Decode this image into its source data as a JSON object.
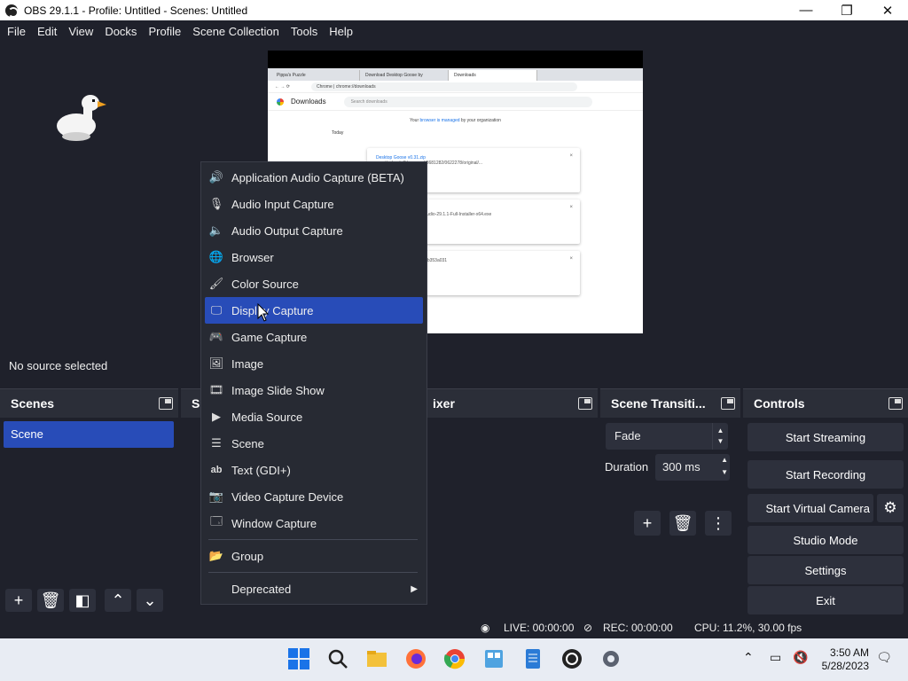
{
  "window": {
    "title": "OBS 29.1.1 - Profile: Untitled - Scenes: Untitled",
    "minimize": "—",
    "maximize": "❐",
    "close": "✕"
  },
  "menubar": [
    "File",
    "Edit",
    "View",
    "Docks",
    "Profile",
    "Scene Collection",
    "Tools",
    "Help"
  ],
  "preview_browser": {
    "tabs": [
      "Pippa's Puzzle",
      "Download Desktop Goose by",
      "Downloads"
    ],
    "url": "Chrome | chrome://downloads",
    "heading": "Downloads",
    "search_placeholder": "Search downloads",
    "managed_pre": "Your ",
    "managed_link": "browser is managed",
    "managed_post": " by your organization",
    "today": "Today",
    "cards": [
      {
        "name": "Desktop Goose v0.31.zip",
        "detail": "...net/uploads/5/gumroad/3681282/0622278/original/..."
      },
      {
        "name": "...dio-x64.exe",
        "detail": "...com/downloads/OBS-Studio-29.1.1-Full-Installer-x64.exe"
      },
      {
        "name": "",
        "detail": "...e-a78b-43dc-8608-33eab353a031"
      }
    ]
  },
  "source_bar": {
    "text": "No source selected"
  },
  "scenes_dock": {
    "title": "Scenes",
    "items": [
      "Scene"
    ]
  },
  "sources_dock": {
    "title_partial": "Sc"
  },
  "mixer_dock": {
    "title_partial": "ixer"
  },
  "transitions_dock": {
    "title": "Scene Transiti...",
    "transition": "Fade",
    "duration_label": "Duration",
    "duration_value": "300 ms"
  },
  "controls_dock": {
    "title": "Controls",
    "buttons": [
      "Start Streaming",
      "Start Recording",
      "Start Virtual Camera",
      "Studio Mode",
      "Settings",
      "Exit"
    ]
  },
  "context_menu": {
    "items": [
      {
        "label": "Application Audio Capture (BETA)",
        "icon": "app-audio-icon"
      },
      {
        "label": "Audio Input Capture",
        "icon": "microphone-icon"
      },
      {
        "label": "Audio Output Capture",
        "icon": "speaker-icon"
      },
      {
        "label": "Browser",
        "icon": "globe-icon"
      },
      {
        "label": "Color Source",
        "icon": "brush-icon"
      },
      {
        "label": "Display Capture",
        "icon": "monitor-icon"
      },
      {
        "label": "Game Capture",
        "icon": "gamepad-icon"
      },
      {
        "label": "Image",
        "icon": "image-icon"
      },
      {
        "label": "Image Slide Show",
        "icon": "slideshow-icon"
      },
      {
        "label": "Media Source",
        "icon": "play-icon"
      },
      {
        "label": "Scene",
        "icon": "list-icon"
      },
      {
        "label": "Text (GDI+)",
        "icon": "text-icon"
      },
      {
        "label": "Video Capture Device",
        "icon": "camera-icon"
      },
      {
        "label": "Window Capture",
        "icon": "window-icon"
      },
      {
        "label": "Group",
        "icon": "folder-icon"
      },
      {
        "label": "Deprecated",
        "icon": ""
      }
    ],
    "highlighted": "Display Capture"
  },
  "status": {
    "live": "LIVE: 00:00:00",
    "rec": "REC: 00:00:00",
    "cpu": "CPU: 11.2%, 30.00 fps"
  },
  "taskbar": {
    "time": "3:50 AM",
    "date": "5/28/2023"
  },
  "colors": {
    "accent": "#284cb8",
    "background": "#1f212b",
    "panel": "#272a33",
    "button": "#2d303c"
  }
}
